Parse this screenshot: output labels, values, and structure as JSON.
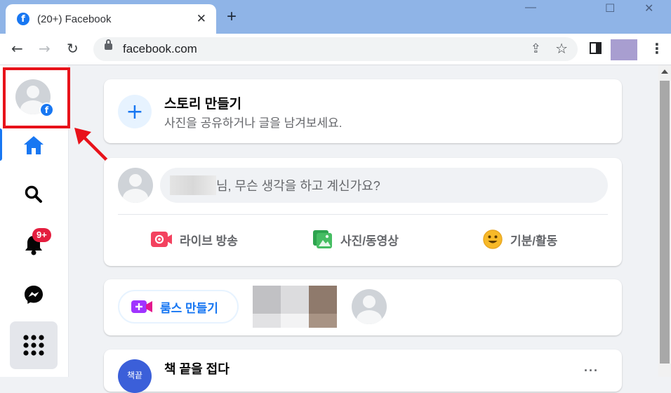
{
  "browser": {
    "tab_title": "(20+) Facebook",
    "favicon_letter": "f",
    "tab_close": "✕",
    "new_tab": "+",
    "window_minimize": "—",
    "window_maximize": "☐",
    "window_close": "✕",
    "url": "facebook.com",
    "back": "←",
    "forward": "→",
    "reload": "↻",
    "star": "☆",
    "share": "⇪",
    "menu": "⋮",
    "accent": "#8fb4e7"
  },
  "leftnav": {
    "badge_letter": "f",
    "notifications_count": "9+",
    "brand_color": "#1877f2"
  },
  "story": {
    "plus": "+",
    "title": "스토리 만들기",
    "subtitle": "사진을 공유하거나 글을 남겨보세요."
  },
  "composer": {
    "placeholder": "님, 무슨 생각을 하고 계신가요?",
    "actions": [
      {
        "label": "라이브 방송",
        "icon": "live-video-icon",
        "color": "#f3425f"
      },
      {
        "label": "사진/동영상",
        "icon": "photo-video-icon",
        "color": "#45bd62"
      },
      {
        "label": "기분/활동",
        "icon": "feeling-icon",
        "color": "#f7b928"
      }
    ]
  },
  "rooms": {
    "label": "룸스 만들기"
  },
  "post": {
    "avatar_text": "책끝",
    "title": "책 끝을 접다",
    "more": "···"
  }
}
